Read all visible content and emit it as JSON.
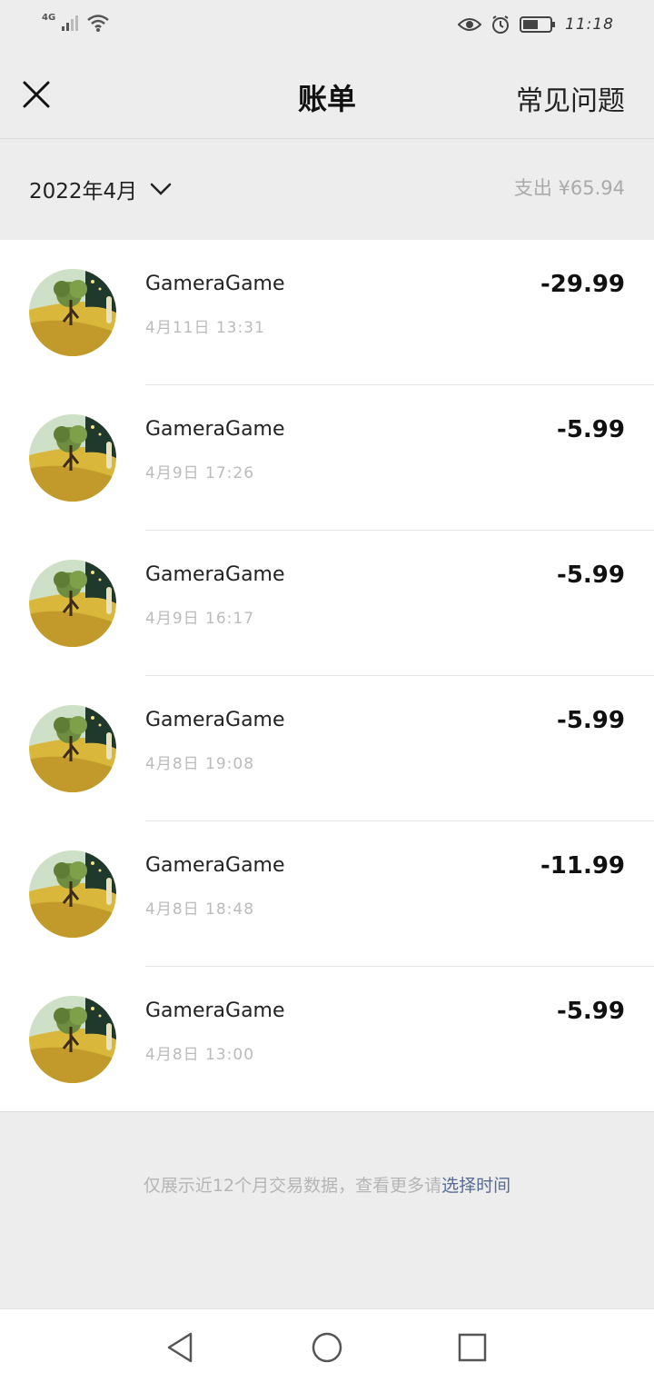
{
  "status_bar": {
    "network": "4G",
    "time": "11:18"
  },
  "header": {
    "title": "账单",
    "faq_label": "常见问题"
  },
  "filter": {
    "month": "2022年4月",
    "spend_summary": "支出 ¥65.94"
  },
  "transactions": [
    {
      "merchant": "GameraGame",
      "time": "4月11日 13:31",
      "amount": "-29.99"
    },
    {
      "merchant": "GameraGame",
      "time": "4月9日 17:26",
      "amount": "-5.99"
    },
    {
      "merchant": "GameraGame",
      "time": "4月9日 16:17",
      "amount": "-5.99"
    },
    {
      "merchant": "GameraGame",
      "time": "4月8日 19:08",
      "amount": "-5.99"
    },
    {
      "merchant": "GameraGame",
      "time": "4月8日 18:48",
      "amount": "-11.99"
    },
    {
      "merchant": "GameraGame",
      "time": "4月8日 13:00",
      "amount": "-5.99"
    }
  ],
  "footer": {
    "note": "仅展示近12个月交易数据，查看更多请",
    "link": "选择时间"
  },
  "colors": {
    "background": "#ededed",
    "link": "#576b95",
    "card": "#ffffff"
  },
  "icons": [
    "signal-icon",
    "wifi-icon",
    "eye-icon",
    "alarm-icon",
    "battery-icon",
    "close-icon",
    "chevron-down-icon",
    "back-triangle-icon",
    "home-circle-icon",
    "recents-square-icon"
  ]
}
